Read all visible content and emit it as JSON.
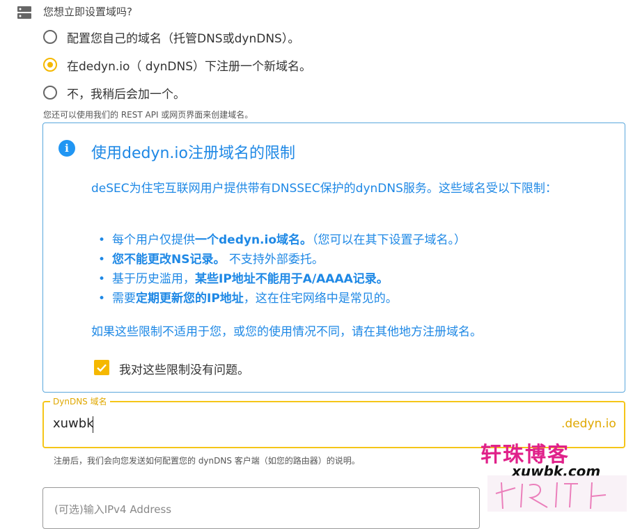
{
  "header": {
    "question": "您想立即设置域吗?"
  },
  "radio_options": [
    {
      "label": "配置您自己的域名（托管DNS或dynDNS）。",
      "selected": false
    },
    {
      "label": "在dedyn.io（ dynDNS）下注册一个新域名。",
      "selected": true
    },
    {
      "label": "不，我稍后会加一个。",
      "selected": false
    }
  ],
  "hint": "您还可以使用我们的 REST API 或网页界面来创建域名。",
  "info": {
    "title": "使用dedyn.io注册域名的限制",
    "intro": "deSEC为住宅互联网用户提供带有DNSSEC保护的dynDNS服务。这些域名受以下限制：",
    "bullets": [
      {
        "pre": "每个用户仅提供",
        "bold": "一个dedyn.io域名。",
        "post": "（您可以在其下设置子域名。）"
      },
      {
        "pre": "",
        "bold": "您不能更改NS记录。",
        "post": " 不支持外部委托。"
      },
      {
        "pre": "基于历史滥用，",
        "bold": "某些IP地址不能用于A/AAAA记录。",
        "post": ""
      },
      {
        "pre": "需要",
        "bold": "定期更新您的IP地址",
        "post": "，这在住宅网络中是常见的。"
      }
    ],
    "closing": "如果这些限制不适用于您，或您的使用情况不同，请在其他地方注册域名。",
    "checkbox_label": "我对这些限制没有问题。",
    "checkbox_checked": true
  },
  "domain_field": {
    "legend": "DynDNS 域名",
    "value": "xuwbk",
    "suffix": ".dedyn.io",
    "hint": "注册后，我们会向您发送如何配置您的 dynDNS 客户端（如您的路由器）的说明。"
  },
  "next_field": {
    "label": "(可选)输入IPv4 Address"
  },
  "watermark": {
    "title": "轩珠博客",
    "url": "xuwbk.com"
  },
  "colors": {
    "accent": "#f5b800",
    "info": "#1e88e5",
    "watermark": "#e0218a"
  }
}
